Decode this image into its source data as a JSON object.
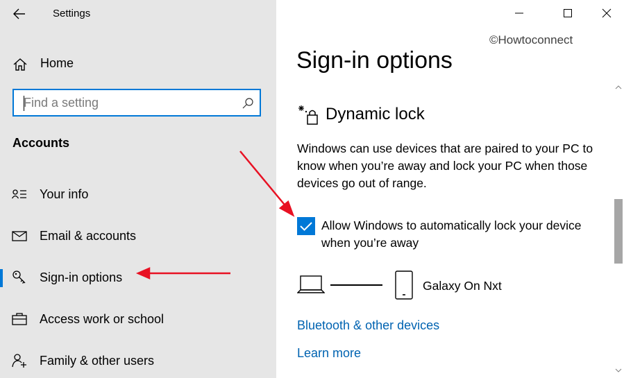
{
  "window": {
    "title": "Settings",
    "back_icon": "arrow-left-icon",
    "controls": [
      "minimize-icon",
      "maximize-icon",
      "close-icon"
    ]
  },
  "sidebar": {
    "home": {
      "label": "Home",
      "icon": "home-icon"
    },
    "search": {
      "placeholder": "Find a setting",
      "value": "",
      "icon": "search-icon"
    },
    "section": "Accounts",
    "items": [
      {
        "label": "Your info",
        "icon": "person-list-icon",
        "selected": false
      },
      {
        "label": "Email & accounts",
        "icon": "mail-icon",
        "selected": false
      },
      {
        "label": "Sign-in options",
        "icon": "key-icon",
        "selected": true
      },
      {
        "label": "Access work or school",
        "icon": "briefcase-icon",
        "selected": false
      },
      {
        "label": "Family & other users",
        "icon": "person-add-icon",
        "selected": false
      }
    ]
  },
  "main": {
    "watermark": "©Howtoconnect",
    "title": "Sign-in options",
    "dynamic_lock": {
      "icon": "dynamic-lock-icon",
      "heading": "Dynamic lock",
      "description": "Windows can use devices that are paired to your PC to know when you’re away and lock your PC when those devices go out of range.",
      "checkbox": {
        "checked": true,
        "label": "Allow Windows to automatically lock your device when you’re away"
      },
      "paired_device": {
        "pc_icon": "laptop-icon",
        "phone_icon": "phone-icon",
        "name": "Galaxy On Nxt"
      },
      "links": [
        "Bluetooth & other devices",
        "Learn more"
      ]
    }
  },
  "colors": {
    "accent": "#0078d7",
    "link": "#0063b1",
    "sidebar_bg": "#e6e6e6",
    "annotation_arrow": "#e81123"
  },
  "scrollbar": {
    "position_fraction": 0.4
  }
}
